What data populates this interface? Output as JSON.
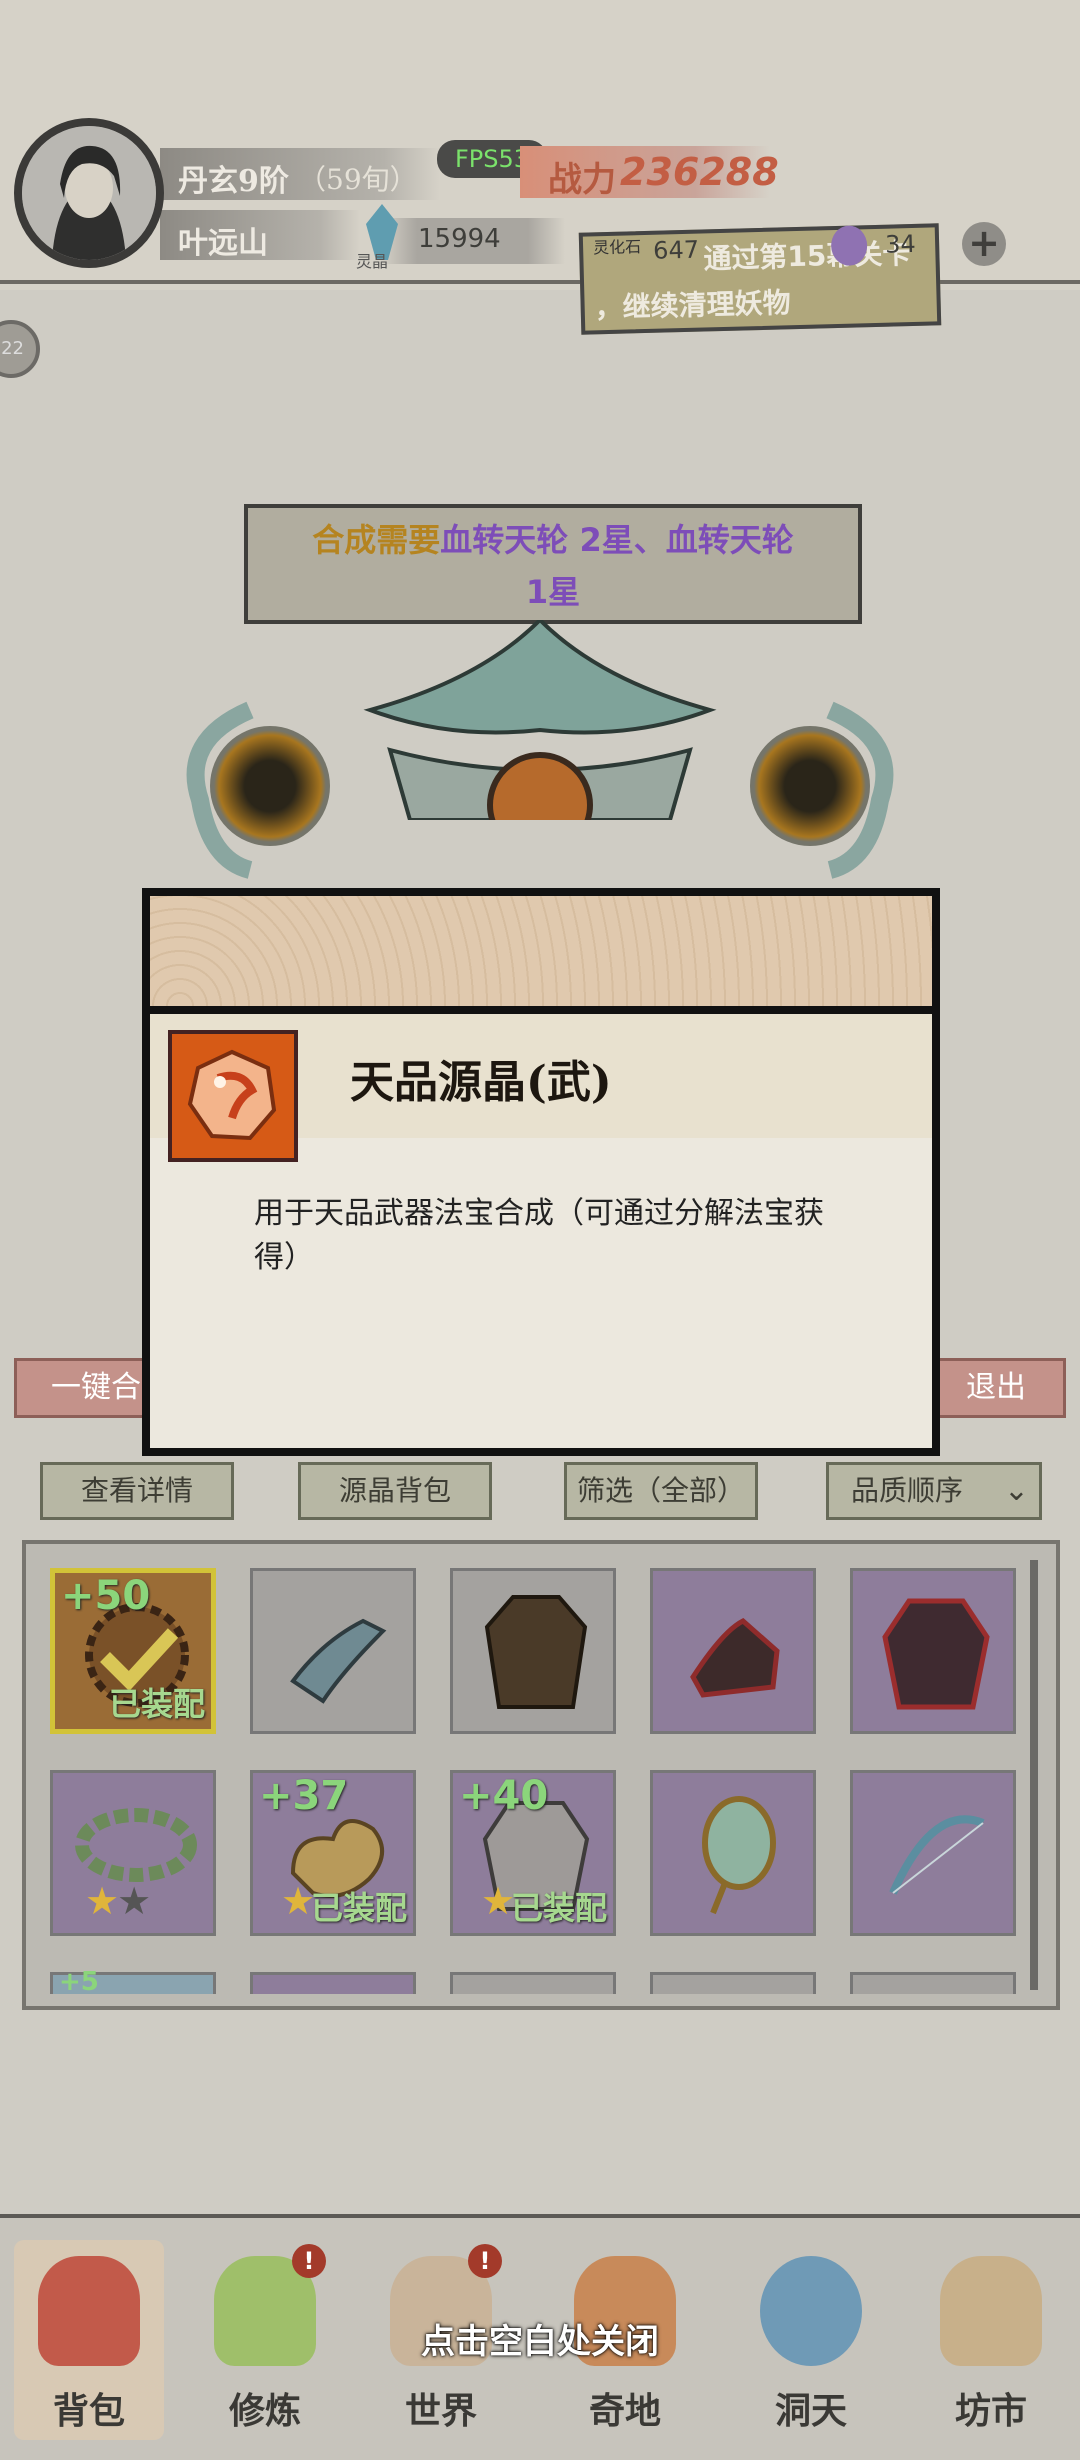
{
  "header": {
    "rank": "丹玄9阶",
    "age": "（59旬）",
    "player_name": "叶远山",
    "fps": "FPS53",
    "power_label": "战力",
    "power_value": "236288",
    "crystal_label": "灵晶",
    "crystal_value": "15994",
    "stone_label": "灵化石",
    "stone_value": "647",
    "spirit_value": "34",
    "quest_text_line1": "通过第15幕关卡",
    "quest_text_line2": "，继续清理妖物",
    "side_badge": "22"
  },
  "synthesis": {
    "prefix": "合成需要",
    "items": "血转天轮 2星、血转天轮",
    "line2": "1星"
  },
  "actions": {
    "one_key": "一键合",
    "exit": "退出"
  },
  "modal": {
    "item_name": "天品源晶(武)",
    "description": "用于天品武器法宝合成（可通过分解法宝获得）"
  },
  "tabs": {
    "details": "查看详情",
    "bag": "源晶背包",
    "filter": "筛选（全部）",
    "sort": "品质顺序"
  },
  "inventory": {
    "row1": [
      {
        "level": "+50",
        "equipped": "已装配"
      },
      {},
      {},
      {},
      {}
    ],
    "row2": [
      {
        "stars_filled": "★",
        "stars_empty": "★"
      },
      {
        "level": "+37",
        "equipped": "已装配",
        "stars_filled": "★"
      },
      {
        "level": "+40",
        "equipped": "已装配",
        "stars_filled": "★"
      },
      {},
      {}
    ],
    "row3_partial": "+5"
  },
  "nav": {
    "items": [
      "背包",
      "修炼",
      "世界",
      "奇地",
      "洞天",
      "坊市"
    ],
    "alert": "!"
  },
  "close_hint": "点击空白处关闭",
  "colors": {
    "accent_red": "#c4928a",
    "item_orange": "#d65a16",
    "level_green": "#8bd57b",
    "synth_purple": "#7d4db8",
    "synth_gold": "#b58420"
  }
}
